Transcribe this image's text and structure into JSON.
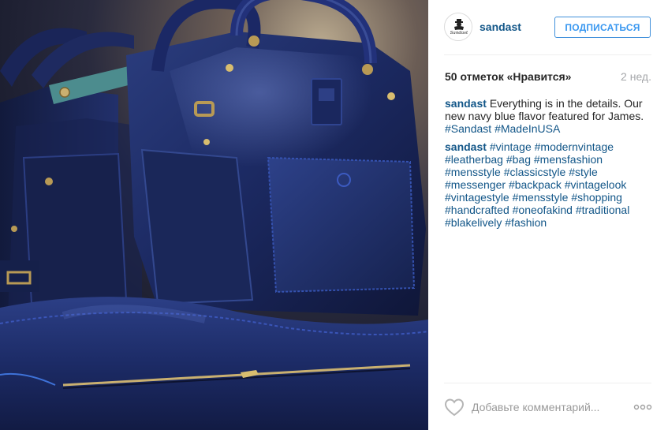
{
  "photo": {
    "alt_subject": "navy leather bags"
  },
  "header": {
    "username": "sandast",
    "follow_label": "ПОДПИСАТЬСЯ",
    "avatar_text": "Sandast"
  },
  "meta": {
    "likes": "50 отметок «Нравится»",
    "time": "2 нед."
  },
  "comments": [
    {
      "author": "sandast",
      "text": "Everything is in the details. Our new navy blue flavor featured for James.",
      "tags": [
        "#Sandast",
        "#MadeInUSA"
      ]
    },
    {
      "author": "sandast",
      "tags": [
        "#vintage",
        "#modernvintage",
        "#leatherbag",
        "#bag",
        "#mensfashion",
        "#mensstyle",
        "#classicstyle",
        "#style",
        "#messenger",
        "#backpack",
        "#vintagelook",
        "#vintagestyle",
        "#mensstyle",
        "#shopping",
        "#handcrafted",
        "#oneofakind",
        "#traditional",
        "#blakelively",
        "#fashion"
      ]
    }
  ],
  "footer": {
    "comment_placeholder": "Добавьте комментарий...",
    "like_icon": "heart-icon",
    "more_icon": "more-options-icon"
  },
  "colors": {
    "link": "#125688",
    "follow": "#3897f0",
    "muted": "#a5a7aa",
    "divider": "#efefef"
  }
}
